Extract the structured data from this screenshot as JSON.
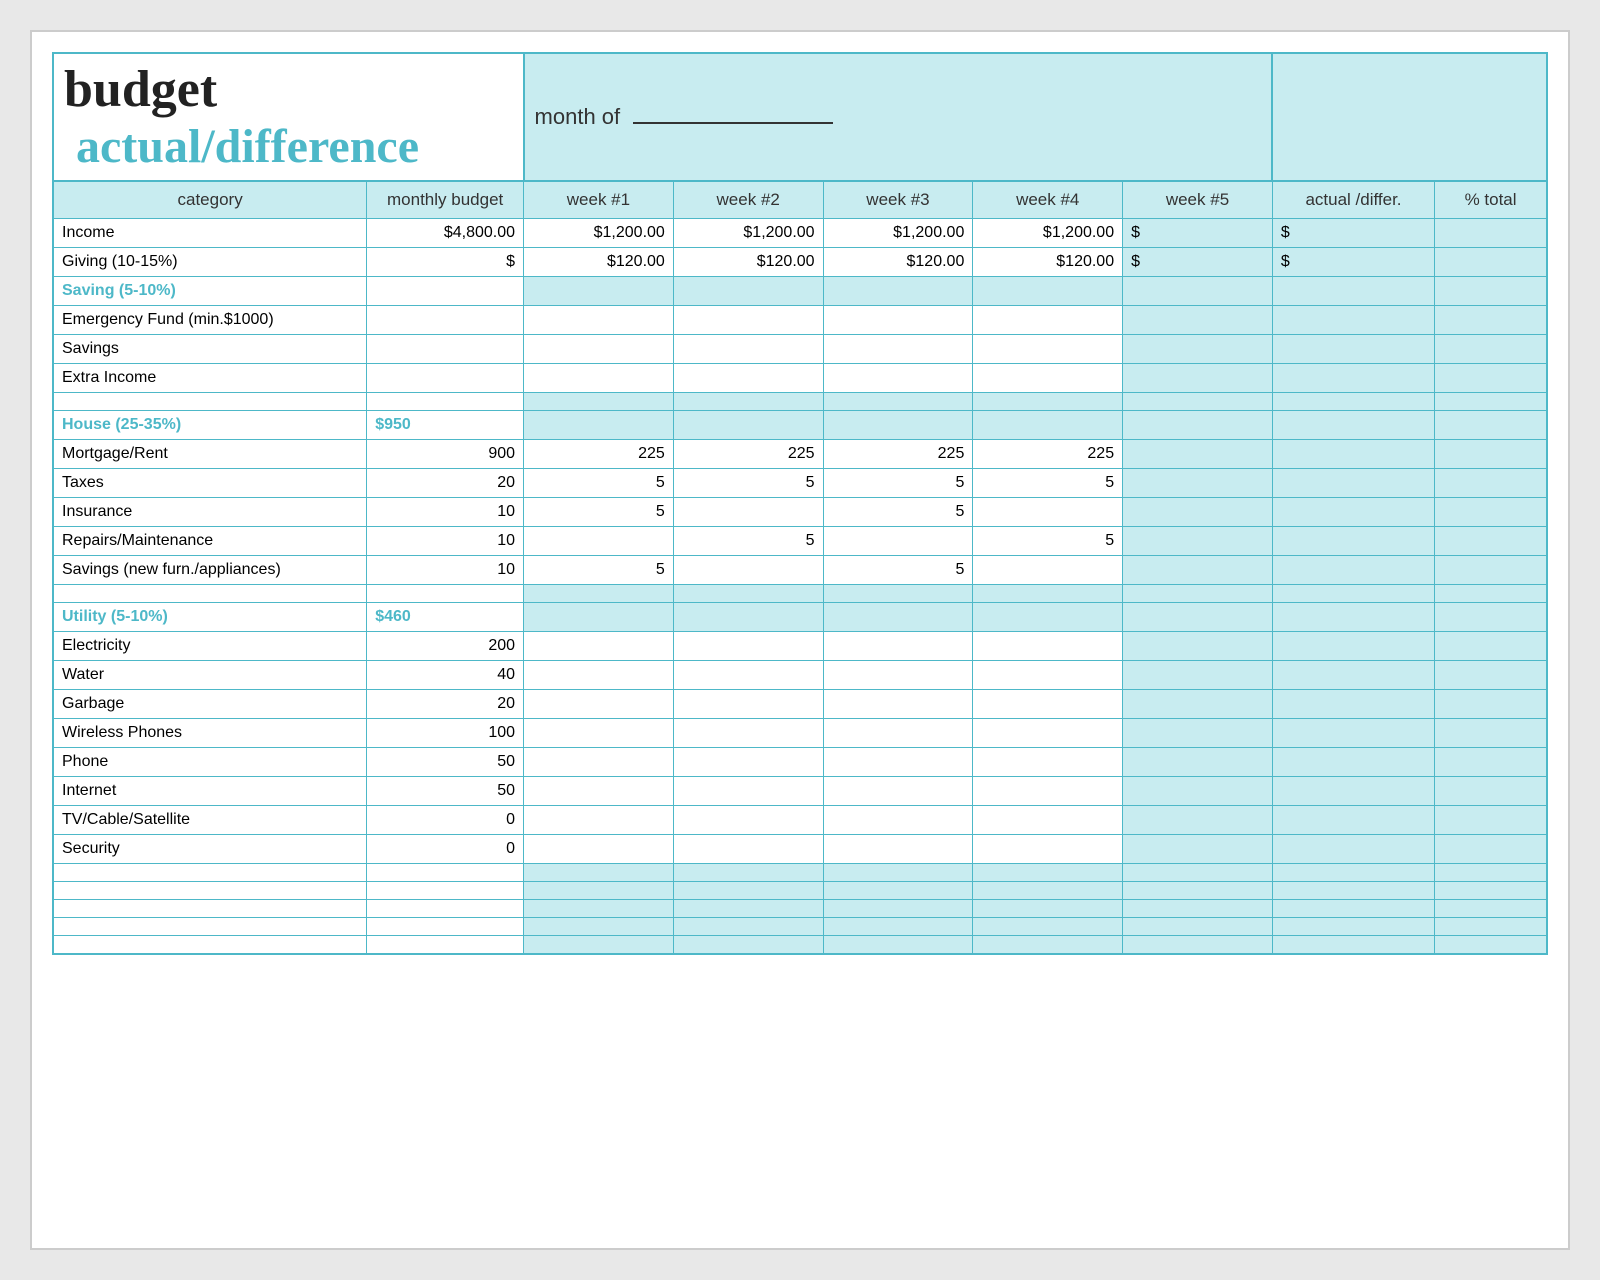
{
  "header": {
    "title_budget": "budget",
    "title_actual": "actual/difference",
    "month_label": "month of",
    "col_category": "category",
    "col_monthly_budget": "monthly budget",
    "col_week1": "week #1",
    "col_week2": "week #2",
    "col_week3": "week #3",
    "col_week4": "week #4",
    "col_week5": "week #5",
    "col_actual": "actual /differ.",
    "col_pct": "% total"
  },
  "sections": [
    {
      "type": "income",
      "label": "Income",
      "monthly_budget": "$4,800.00",
      "week1": "$1,200.00",
      "week2": "$1,200.00",
      "week3": "$1,200.00",
      "week4": "$1,200.00",
      "week5": "$",
      "actual": "$"
    },
    {
      "type": "data",
      "label": "Giving (10-15%)",
      "monthly_budget": "$",
      "week1": "$120.00",
      "week2": "$120.00",
      "week3": "$120.00",
      "week4": "$120.00",
      "week5": "$",
      "actual": "$"
    },
    {
      "type": "section_header",
      "label": "Saving (5-10%)",
      "monthly_budget": ""
    },
    {
      "type": "data",
      "label": "Emergency Fund (min.$1000)",
      "monthly_budget": "",
      "week1": "",
      "week2": "",
      "week3": "",
      "week4": "",
      "week5": "",
      "actual": ""
    },
    {
      "type": "data",
      "label": "Savings",
      "monthly_budget": "",
      "week1": "",
      "week2": "",
      "week3": "",
      "week4": "",
      "week5": "",
      "actual": ""
    },
    {
      "type": "data",
      "label": "Extra Income",
      "monthly_budget": "",
      "week1": "",
      "week2": "",
      "week3": "",
      "week4": "",
      "week5": "",
      "actual": ""
    },
    {
      "type": "spacer"
    },
    {
      "type": "section_header",
      "label": "House (25-35%)",
      "monthly_budget": "$950"
    },
    {
      "type": "data",
      "label": "Mortgage/Rent",
      "monthly_budget": "900",
      "week1": "225",
      "week2": "225",
      "week3": "225",
      "week4": "225",
      "week5": "",
      "actual": ""
    },
    {
      "type": "data",
      "label": "Taxes",
      "monthly_budget": "20",
      "week1": "5",
      "week2": "5",
      "week3": "5",
      "week4": "5",
      "week5": "",
      "actual": ""
    },
    {
      "type": "data",
      "label": "Insurance",
      "monthly_budget": "10",
      "week1": "5",
      "week2": "",
      "week3": "5",
      "week4": "",
      "week5": "",
      "actual": ""
    },
    {
      "type": "data",
      "label": "Repairs/Maintenance",
      "monthly_budget": "10",
      "week1": "",
      "week2": "5",
      "week3": "",
      "week4": "5",
      "week5": "",
      "actual": ""
    },
    {
      "type": "data",
      "label": "Savings (new furn./appliances)",
      "monthly_budget": "10",
      "week1": "5",
      "week2": "",
      "week3": "5",
      "week4": "",
      "week5": "",
      "actual": ""
    },
    {
      "type": "spacer"
    },
    {
      "type": "section_header",
      "label": "Utility (5-10%)",
      "monthly_budget": "$460"
    },
    {
      "type": "data",
      "label": "Electricity",
      "monthly_budget": "200",
      "week1": "",
      "week2": "",
      "week3": "",
      "week4": "",
      "week5": "",
      "actual": ""
    },
    {
      "type": "data",
      "label": "Water",
      "monthly_budget": "40",
      "week1": "",
      "week2": "",
      "week3": "",
      "week4": "",
      "week5": "",
      "actual": ""
    },
    {
      "type": "data",
      "label": "Garbage",
      "monthly_budget": "20",
      "week1": "",
      "week2": "",
      "week3": "",
      "week4": "",
      "week5": "",
      "actual": ""
    },
    {
      "type": "data",
      "label": "Wireless Phones",
      "monthly_budget": "100",
      "week1": "",
      "week2": "",
      "week3": "",
      "week4": "",
      "week5": "",
      "actual": ""
    },
    {
      "type": "data",
      "label": "Phone",
      "monthly_budget": "50",
      "week1": "",
      "week2": "",
      "week3": "",
      "week4": "",
      "week5": "",
      "actual": ""
    },
    {
      "type": "data",
      "label": "Internet",
      "monthly_budget": "50",
      "week1": "",
      "week2": "",
      "week3": "",
      "week4": "",
      "week5": "",
      "actual": ""
    },
    {
      "type": "data",
      "label": "TV/Cable/Satellite",
      "monthly_budget": "0",
      "week1": "",
      "week2": "",
      "week3": "",
      "week4": "",
      "week5": "",
      "actual": ""
    },
    {
      "type": "data",
      "label": "Security",
      "monthly_budget": "0",
      "week1": "",
      "week2": "",
      "week3": "",
      "week4": "",
      "week5": "",
      "actual": ""
    },
    {
      "type": "spacer"
    },
    {
      "type": "spacer"
    },
    {
      "type": "spacer"
    },
    {
      "type": "spacer"
    },
    {
      "type": "spacer"
    }
  ],
  "colors": {
    "teal": "#4db8c8",
    "light_teal_bg": "#c8ecf0",
    "text_dark": "#222"
  }
}
